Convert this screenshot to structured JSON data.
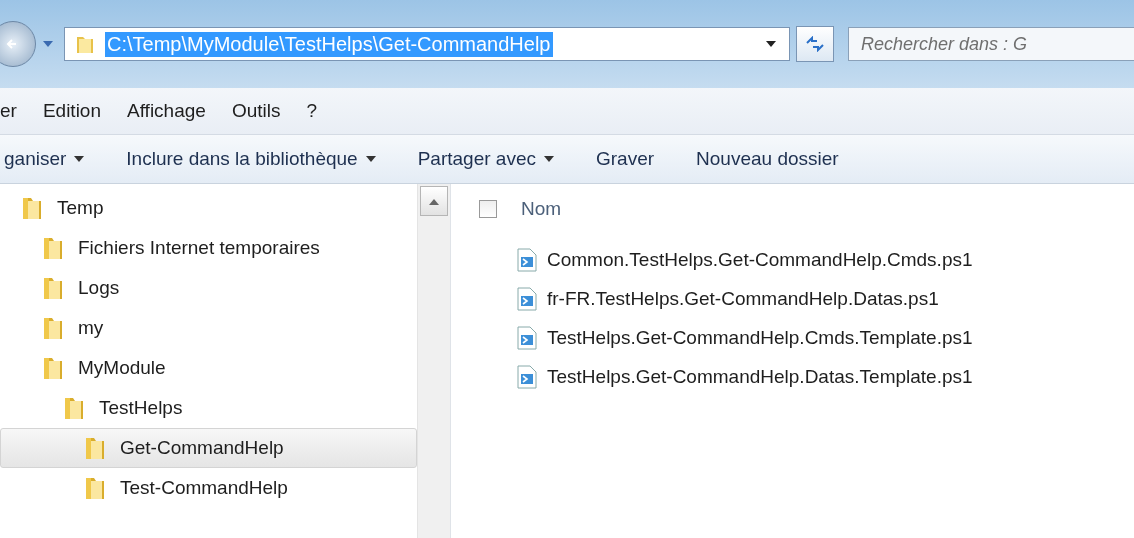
{
  "address_bar": {
    "path": "C:\\Temp\\MyModule\\TestHelps\\Get-CommandHelp",
    "path_selected": true
  },
  "search": {
    "placeholder": "Rechercher dans : G"
  },
  "menu": [
    {
      "label": "er"
    },
    {
      "label": "Edition"
    },
    {
      "label": "Affichage"
    },
    {
      "label": "Outils"
    },
    {
      "label": "?"
    }
  ],
  "toolbar": [
    {
      "label": "ganiser",
      "has_menu": true
    },
    {
      "label": "Inclure dans la bibliothèque",
      "has_menu": true
    },
    {
      "label": "Partager avec",
      "has_menu": true
    },
    {
      "label": "Graver",
      "has_menu": false
    },
    {
      "label": "Nouveau dossier",
      "has_menu": false
    }
  ],
  "tree": [
    {
      "label": "Temp",
      "selected": false,
      "children": [
        {
          "label": "Fichiers Internet temporaires",
          "selected": false
        },
        {
          "label": "Logs",
          "selected": false
        },
        {
          "label": "my",
          "selected": false
        },
        {
          "label": "MyModule",
          "selected": false,
          "children": [
            {
              "label": "TestHelps",
              "selected": false,
              "children": [
                {
                  "label": "Get-CommandHelp",
                  "selected": true
                },
                {
                  "label": "Test-CommandHelp",
                  "selected": false
                }
              ]
            }
          ]
        }
      ]
    }
  ],
  "file_list": {
    "select_all_checked": false,
    "column": "Nom",
    "files": [
      {
        "name": "Common.TestHelps.Get-CommandHelp.Cmds.ps1"
      },
      {
        "name": "fr-FR.TestHelps.Get-CommandHelp.Datas.ps1"
      },
      {
        "name": "TestHelps.Get-CommandHelp.Cmds.Template.ps1"
      },
      {
        "name": "TestHelps.Get-CommandHelp.Datas.Template.ps1"
      }
    ]
  }
}
